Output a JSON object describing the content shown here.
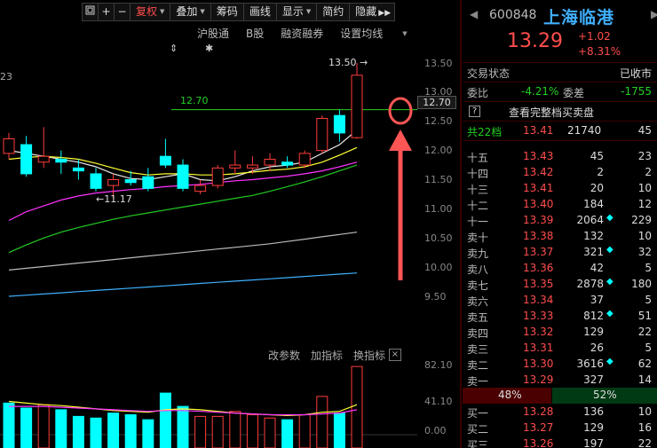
{
  "toolbar": {
    "items": [
      {
        "label": "复权",
        "active": true
      },
      {
        "label": "叠加"
      },
      {
        "label": "筹码"
      },
      {
        "label": "画线"
      },
      {
        "label": "显示"
      },
      {
        "label": "简约"
      },
      {
        "label": "隐藏"
      }
    ],
    "more_icon": "double-chevron-right-icon",
    "frame_icon": "frame-icon",
    "plus_label": "+",
    "minus_label": "−"
  },
  "subtoolbar": {
    "items": [
      "沪股通",
      "B股",
      "融资融券",
      "设置均线"
    ],
    "markers": {
      "arrow": "⇕",
      "star": "✱"
    }
  },
  "chart": {
    "corner_label": "23",
    "high_label": "13.50",
    "low_label": "11.17",
    "ref_line_label": "12.70",
    "price_box": "12.70",
    "y_axis": [
      "13.50",
      "13.00",
      "12.50",
      "12.00",
      "11.50",
      "11.00",
      "10.50",
      "10.00",
      "9.50"
    ],
    "annotation_color": "#ff5555"
  },
  "chart_data": [
    {
      "type": "candlestick",
      "ylim": [
        9.3,
        13.7
      ],
      "candles": [
        {
          "o": 11.95,
          "h": 12.3,
          "l": 11.85,
          "c": 12.2
        },
        {
          "o": 12.1,
          "h": 12.25,
          "l": 11.55,
          "c": 11.6
        },
        {
          "o": 11.8,
          "h": 12.4,
          "l": 11.7,
          "c": 11.9
        },
        {
          "o": 11.85,
          "h": 12.0,
          "l": 11.6,
          "c": 11.8
        },
        {
          "o": 11.7,
          "h": 11.85,
          "l": 11.5,
          "c": 11.65
        },
        {
          "o": 11.6,
          "h": 11.7,
          "l": 11.3,
          "c": 11.35
        },
        {
          "o": 11.4,
          "h": 11.6,
          "l": 11.17,
          "c": 11.5
        },
        {
          "o": 11.5,
          "h": 11.65,
          "l": 11.4,
          "c": 11.45
        },
        {
          "o": 11.55,
          "h": 11.7,
          "l": 11.3,
          "c": 11.35
        },
        {
          "o": 11.9,
          "h": 12.2,
          "l": 11.7,
          "c": 11.75
        },
        {
          "o": 11.75,
          "h": 11.85,
          "l": 11.3,
          "c": 11.35
        },
        {
          "o": 11.3,
          "h": 11.5,
          "l": 11.25,
          "c": 11.4
        },
        {
          "o": 11.4,
          "h": 11.75,
          "l": 11.35,
          "c": 11.7
        },
        {
          "o": 11.7,
          "h": 12.0,
          "l": 11.6,
          "c": 11.75
        },
        {
          "o": 11.7,
          "h": 11.9,
          "l": 11.6,
          "c": 11.75
        },
        {
          "o": 11.75,
          "h": 11.95,
          "l": 11.65,
          "c": 11.85
        },
        {
          "o": 11.8,
          "h": 11.9,
          "l": 11.7,
          "c": 11.75
        },
        {
          "o": 11.75,
          "h": 12.0,
          "l": 11.7,
          "c": 11.95
        },
        {
          "o": 12.0,
          "h": 12.6,
          "l": 11.95,
          "c": 12.55
        },
        {
          "o": 12.6,
          "h": 12.7,
          "l": 12.15,
          "c": 12.3
        },
        {
          "o": 12.22,
          "h": 13.5,
          "l": 12.2,
          "c": 13.29
        }
      ],
      "ma_lines": [
        {
          "name": "white",
          "color": "#e8e8e8",
          "values": [
            12.0,
            11.95,
            11.9,
            11.85,
            11.8,
            11.72,
            11.6,
            11.52,
            11.5,
            11.55,
            11.6,
            11.5,
            11.48,
            11.55,
            11.65,
            11.72,
            11.75,
            11.8,
            11.95,
            12.1,
            12.35
          ]
        },
        {
          "name": "yellow",
          "color": "#ffff33",
          "values": [
            11.85,
            11.88,
            11.9,
            11.88,
            11.85,
            11.78,
            11.7,
            11.62,
            11.58,
            11.6,
            11.6,
            11.58,
            11.58,
            11.6,
            11.63,
            11.66,
            11.68,
            11.72,
            11.8,
            11.92,
            12.05
          ]
        },
        {
          "name": "magenta",
          "color": "#ff33ff",
          "values": [
            10.8,
            10.95,
            11.05,
            11.15,
            11.22,
            11.27,
            11.3,
            11.33,
            11.35,
            11.38,
            11.4,
            11.42,
            11.45,
            11.48,
            11.5,
            11.53,
            11.56,
            11.6,
            11.65,
            11.72,
            11.8
          ]
        },
        {
          "name": "green",
          "color": "#22cc22",
          "values": [
            10.25,
            10.38,
            10.5,
            10.6,
            10.68,
            10.75,
            10.82,
            10.88,
            10.93,
            10.98,
            11.03,
            11.08,
            11.13,
            11.18,
            11.23,
            11.3,
            11.38,
            11.46,
            11.55,
            11.65,
            11.75
          ]
        },
        {
          "name": "gray",
          "color": "#bbbbbb",
          "values": [
            9.95,
            9.98,
            10.01,
            10.04,
            10.07,
            10.1,
            10.13,
            10.16,
            10.19,
            10.22,
            10.25,
            10.28,
            10.31,
            10.34,
            10.37,
            10.4,
            10.44,
            10.48,
            10.52,
            10.56,
            10.6
          ]
        },
        {
          "name": "blue",
          "color": "#3fb0ff",
          "values": [
            9.5,
            9.52,
            9.54,
            9.56,
            9.58,
            9.6,
            9.62,
            9.64,
            9.66,
            9.68,
            9.7,
            9.72,
            9.74,
            9.76,
            9.78,
            9.8,
            9.82,
            9.84,
            9.86,
            9.88,
            9.9
          ]
        }
      ]
    },
    {
      "type": "bar",
      "ylim": [
        0,
        82.1
      ],
      "y_axis": [
        "82.10",
        "41.10",
        "0.00"
      ],
      "bars": [
        {
          "v": 38,
          "up": false
        },
        {
          "v": 32,
          "up": false
        },
        {
          "v": 36,
          "up": true
        },
        {
          "v": 30,
          "up": false
        },
        {
          "v": 22,
          "up": false
        },
        {
          "v": 20,
          "up": false
        },
        {
          "v": 26,
          "up": false
        },
        {
          "v": 24,
          "up": false
        },
        {
          "v": 18,
          "up": false
        },
        {
          "v": 50,
          "up": false
        },
        {
          "v": 34,
          "up": false
        },
        {
          "v": 22,
          "up": true
        },
        {
          "v": 22,
          "up": true
        },
        {
          "v": 28,
          "up": true
        },
        {
          "v": 24,
          "up": true
        },
        {
          "v": 20,
          "up": true
        },
        {
          "v": 18,
          "up": false
        },
        {
          "v": 24,
          "up": true
        },
        {
          "v": 46,
          "up": true
        },
        {
          "v": 26,
          "up": false
        },
        {
          "v": 82,
          "up": true
        }
      ],
      "lines": [
        {
          "color": "#ffff33",
          "values": [
            40,
            38,
            36,
            35,
            33,
            31,
            29,
            28,
            27,
            30,
            31,
            30,
            28,
            26,
            25,
            24,
            23,
            24,
            27,
            28,
            36
          ]
        },
        {
          "color": "#ff33ff",
          "values": [
            34,
            34,
            34,
            33,
            32,
            31,
            30,
            29,
            28,
            29,
            29,
            28,
            27,
            26,
            25,
            24,
            24,
            24,
            25,
            26,
            30
          ]
        }
      ]
    }
  ],
  "indicator": {
    "items": [
      "改参数",
      "加指标",
      "换指标"
    ],
    "close": "×"
  },
  "quote": {
    "nav_left": "◀",
    "nav_right": "▶",
    "code": "600848",
    "name": "上海临港",
    "last": "13.29",
    "change": "+1.02",
    "change_pct": "+8.31%",
    "status_label": "交易状态",
    "status_value": "已收市",
    "weibi_label": "委比",
    "weibi_value": "-4.21%",
    "weicha_label": "委差",
    "weicha_value": "-1755",
    "full_book_icon": "?",
    "full_book_label": "查看完整档买卖盘",
    "total_levels_label": "共22档",
    "total_price": "13.41",
    "total_vol": "21740",
    "total_count": "45",
    "asks": [
      {
        "label": "十五",
        "price": "13.43",
        "vol": "45",
        "diamond": false,
        "cnt": "23"
      },
      {
        "label": "十四",
        "price": "13.42",
        "vol": "2",
        "diamond": false,
        "cnt": "2"
      },
      {
        "label": "十三",
        "price": "13.41",
        "vol": "20",
        "diamond": false,
        "cnt": "10"
      },
      {
        "label": "十二",
        "price": "13.40",
        "vol": "184",
        "diamond": false,
        "cnt": "12"
      },
      {
        "label": "十一",
        "price": "13.39",
        "vol": "2064",
        "diamond": true,
        "cnt": "229"
      },
      {
        "label": "卖十",
        "price": "13.38",
        "vol": "132",
        "diamond": false,
        "cnt": "10"
      },
      {
        "label": "卖九",
        "price": "13.37",
        "vol": "321",
        "diamond": true,
        "cnt": "32"
      },
      {
        "label": "卖八",
        "price": "13.36",
        "vol": "42",
        "diamond": false,
        "cnt": "5"
      },
      {
        "label": "卖七",
        "price": "13.35",
        "vol": "2878",
        "diamond": true,
        "cnt": "180"
      },
      {
        "label": "卖六",
        "price": "13.34",
        "vol": "37",
        "diamond": false,
        "cnt": "5"
      },
      {
        "label": "卖五",
        "price": "13.33",
        "vol": "812",
        "diamond": true,
        "cnt": "51"
      },
      {
        "label": "卖四",
        "price": "13.32",
        "vol": "129",
        "diamond": false,
        "cnt": "22"
      },
      {
        "label": "卖三",
        "price": "13.31",
        "vol": "26",
        "diamond": false,
        "cnt": "5"
      },
      {
        "label": "卖二",
        "price": "13.30",
        "vol": "3616",
        "diamond": true,
        "cnt": "62"
      },
      {
        "label": "卖一",
        "price": "13.29",
        "vol": "327",
        "diamond": false,
        "cnt": "14"
      }
    ],
    "ratio_left": "48%",
    "ratio_right": "52%",
    "bids": [
      {
        "label": "买一",
        "price": "13.28",
        "vol": "136",
        "diamond": false,
        "cnt": "10"
      },
      {
        "label": "买二",
        "price": "13.27",
        "vol": "129",
        "diamond": false,
        "cnt": "16"
      },
      {
        "label": "买三",
        "price": "13.26",
        "vol": "197",
        "diamond": false,
        "cnt": "22"
      }
    ]
  }
}
